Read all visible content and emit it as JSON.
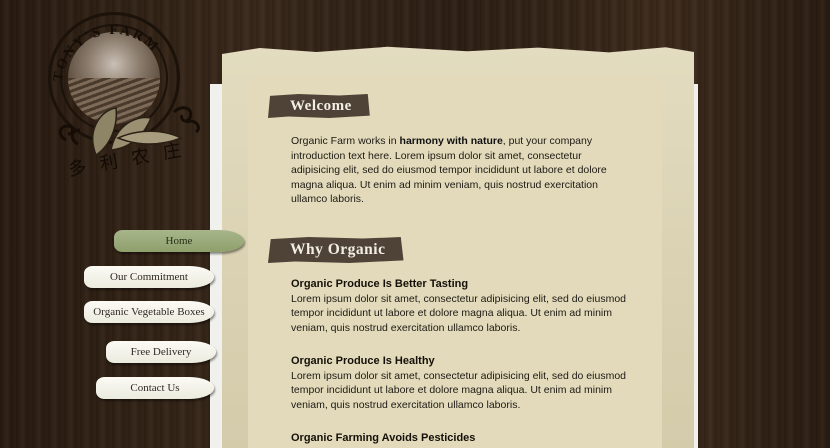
{
  "logo": {
    "arc_text": "TONY'S FARM",
    "chinese": "多利农庄",
    "icon": "farm-logo-icon"
  },
  "nav": {
    "items": [
      {
        "label": "Home",
        "active": true
      },
      {
        "label": "Our Commitment",
        "active": false
      },
      {
        "label": "Organic Vegetable Boxes",
        "active": false
      },
      {
        "label": "Free Delivery",
        "active": false
      },
      {
        "label": "Contact Us",
        "active": false
      }
    ]
  },
  "welcome": {
    "heading": "Welcome",
    "intro_before": "Organic Farm works in ",
    "intro_bold": "harmony with nature",
    "intro_after": ", put your company introduction text here. Lorem ipsum dolor sit amet, consectetur adipisicing elit, sed do eiusmod tempor incididunt ut labore et dolore magna aliqua. Ut enim ad minim veniam, quis nostrud exercitation ullamco laboris."
  },
  "why_organic": {
    "heading": "Why Organic",
    "sections": [
      {
        "title": "Organic Produce Is Better Tasting",
        "body": "Lorem ipsum dolor sit amet, consectetur adipisicing elit, sed do eiusmod tempor incididunt ut labore et dolore magna aliqua. Ut enim ad minim veniam, quis nostrud exercitation ullamco laboris."
      },
      {
        "title": "Organic Produce Is Healthy",
        "body": "Lorem ipsum dolor sit amet, consectetur adipisicing elit, sed do eiusmod tempor incididunt ut labore et dolore magna aliqua. Ut enim ad minim veniam, quis nostrud exercitation ullamco laboris."
      },
      {
        "title": "Organic Farming Avoids Pesticides",
        "body": ""
      }
    ]
  },
  "colors": {
    "wood": "#33241a",
    "paper": "#e2dabb",
    "banner": "#4f4337",
    "nav_active": "#9aab78"
  }
}
